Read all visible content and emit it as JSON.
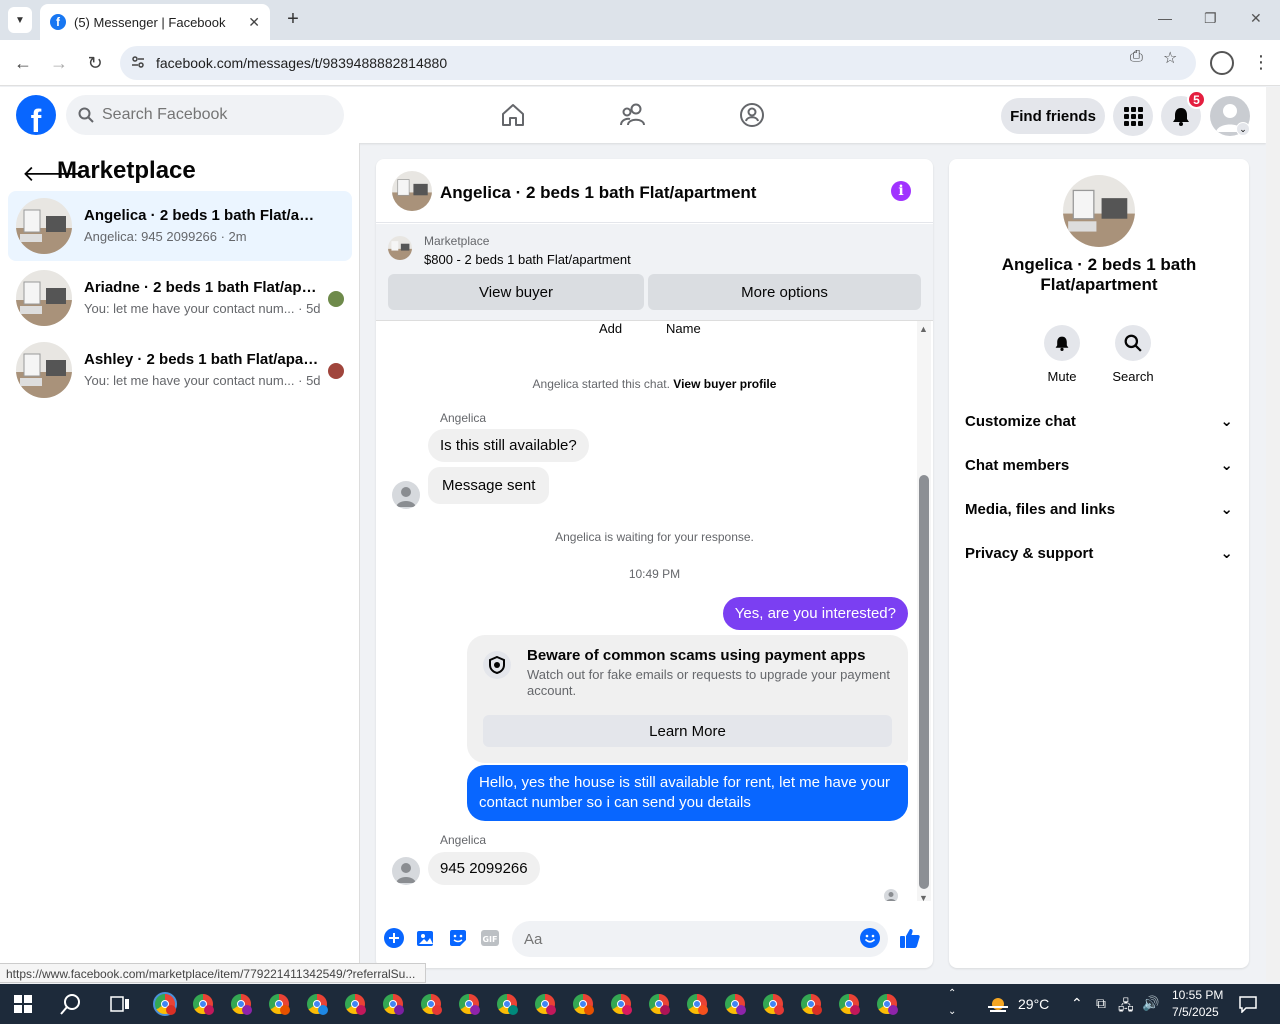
{
  "browser": {
    "tab_count_title": "(5) Messenger | Facebook",
    "url": "facebook.com/messages/t/9839488882814880",
    "status_url": "https://www.facebook.com/marketplace/item/779221411342549/?referralSu..."
  },
  "fb_nav": {
    "search_placeholder": "Search Facebook",
    "find_friends": "Find friends",
    "notif_count": "5"
  },
  "left": {
    "title": "Marketplace",
    "conversations": [
      {
        "name": "Angelica · 2 beds 1 bath Flat/apart...",
        "snippet": "Angelica: 945 2099266 · 2m",
        "active": true
      },
      {
        "name": "Ariadne · 2 beds 1 bath Flat/apa...",
        "snippet": "You: let me have your contact num... · 5d"
      },
      {
        "name": "Ashley · 2 beds 1 bath Flat/apart...",
        "snippet": "You: let me have your contact num... · 5d"
      }
    ]
  },
  "chat": {
    "title": "Angelica · 2 beds 1 bath Flat/apartment",
    "banner_label": "Marketplace",
    "banner_price": "$800 - 2 beds 1 bath Flat/apartment",
    "view_buyer": "View buyer",
    "more_options": "More options",
    "cut_add": "Add",
    "cut_name": "Name",
    "started_text": "Angelica started this chat.",
    "view_buyer_profile": "View buyer profile",
    "sender1": "Angelica",
    "msg1": "Is this still available?",
    "msg2": "Message sent",
    "waiting": "Angelica is waiting for your response.",
    "time": "10:49 PM",
    "out1": "Yes, are you interested?",
    "scam_title": "Beware of common scams using payment apps",
    "scam_desc": "Watch out for fake emails or requests to upgrade your payment account.",
    "learn_more": "Learn More",
    "out2": "Hello, yes the house is still available for rent, let me have your contact number so i can send you details",
    "sender2": "Angelica",
    "msg3": "945 2099266",
    "composer_placeholder": "Aa",
    "out1_color": "#7b3ff2",
    "out2_color": "#0866ff"
  },
  "right": {
    "title": "Angelica · 2 beds 1 bath Flat/apartment",
    "mute": "Mute",
    "search": "Search",
    "rows": [
      "Customize chat",
      "Chat members",
      "Media, files and links",
      "Privacy & support"
    ]
  },
  "taskbar": {
    "weather": "29°C",
    "time": "10:55 PM",
    "date": "7/5/2025"
  }
}
